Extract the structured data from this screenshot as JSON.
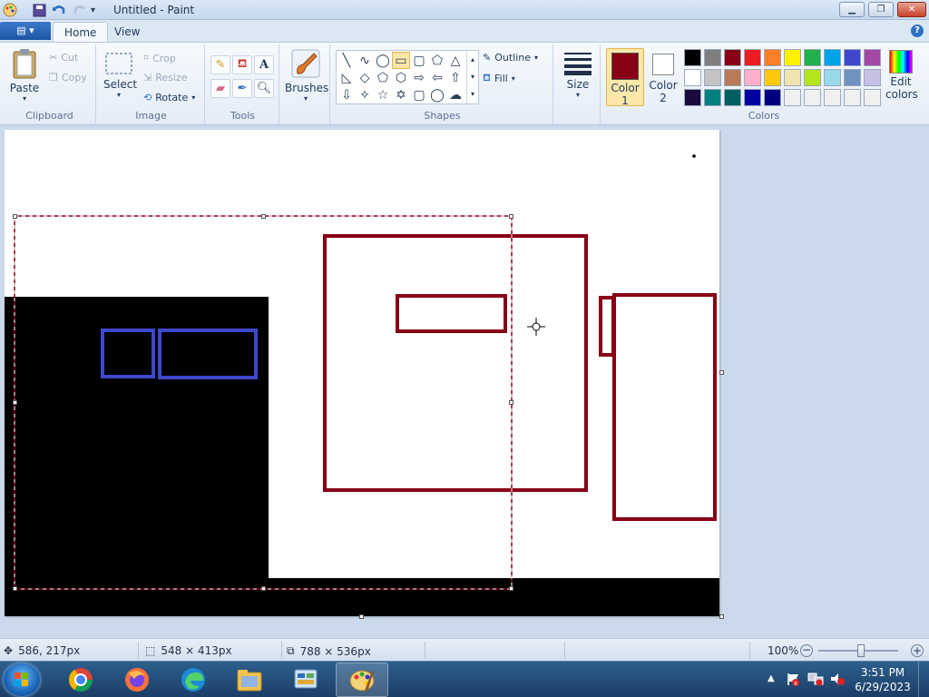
{
  "window": {
    "title": "Untitled - Paint"
  },
  "tabs": {
    "file_glyph": "▤ ▾",
    "home": "Home",
    "view": "View",
    "help": "?"
  },
  "clipboard": {
    "paste": "Paste",
    "cut": "Cut",
    "copy": "Copy",
    "group": "Clipboard"
  },
  "image": {
    "select": "Select",
    "crop": "Crop",
    "resize": "Resize",
    "rotate": "Rotate",
    "group": "Image"
  },
  "tools": {
    "group": "Tools"
  },
  "brushes": {
    "label": "Brushes"
  },
  "shapes": {
    "outline": "Outline",
    "fill": "Fill",
    "group": "Shapes"
  },
  "size": {
    "label": "Size"
  },
  "colors": {
    "color1": "Color",
    "color1_num": "1",
    "color2": "Color",
    "color2_num": "2",
    "edit": "Edit",
    "edit2": "colors",
    "group": "Colors",
    "color1_value": "#880015",
    "color2_value": "#ffffff",
    "palette_row1": [
      "#000000",
      "#7f7f7f",
      "#880015",
      "#ed1c24",
      "#ff7f27",
      "#fff200",
      "#22b14c",
      "#00a2e8",
      "#3f48cc",
      "#a349a4"
    ],
    "palette_row2": [
      "#ffffff",
      "#c3c3c3",
      "#b97a57",
      "#ffaec9",
      "#ffc90e",
      "#efe4b0",
      "#b5e61d",
      "#99d9ea",
      "#7092be",
      "#c8bfe7"
    ],
    "palette_row3": [
      "#1a0a3d",
      "#008080",
      "#006060",
      "#0000a0",
      "#000080",
      "#f0f0f0",
      "#f0f0f0",
      "#f0f0f0",
      "#f0f0f0",
      "#f0f0f0"
    ]
  },
  "status": {
    "cursor_pos": "586, 217px",
    "selection_size": "548 × 413px",
    "canvas_size": "788 × 536px",
    "zoom": "100%"
  },
  "taskbar": {
    "time": "3:51 PM",
    "date": "6/29/2023"
  }
}
